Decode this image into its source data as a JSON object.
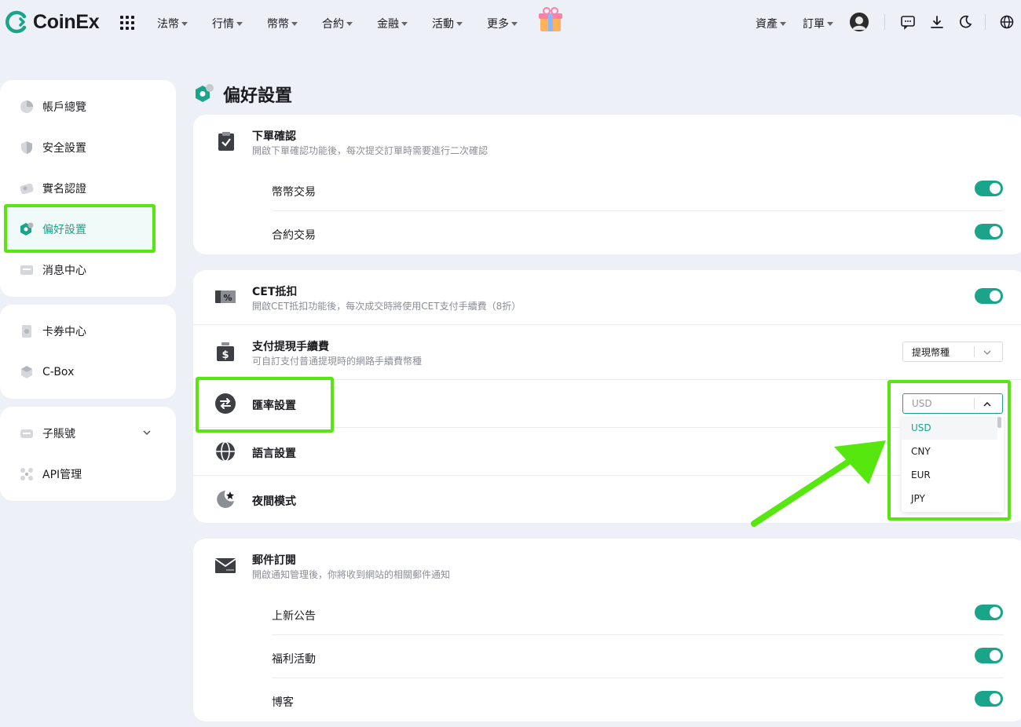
{
  "brand": {
    "name": "CoinEx",
    "accent": "#1aa58a",
    "highlight": "#56e70f"
  },
  "topnav": {
    "menu": [
      {
        "label": "法幣"
      },
      {
        "label": "行情"
      },
      {
        "label": "幣幣"
      },
      {
        "label": "合約"
      },
      {
        "label": "金融"
      },
      {
        "label": "活動"
      },
      {
        "label": "更多"
      }
    ],
    "assets_label": "資產",
    "orders_label": "訂單",
    "icons": [
      "apps-grid-icon",
      "gift-icon",
      "avatar",
      "message-icon",
      "download-icon",
      "moon-icon",
      "globe-icon"
    ]
  },
  "sidebar": {
    "group1": [
      {
        "label": "帳戶總覽",
        "icon": "pie-chart-icon"
      },
      {
        "label": "安全設置",
        "icon": "shield-icon"
      },
      {
        "label": "實名認證",
        "icon": "id-card-icon"
      },
      {
        "label": "偏好設置",
        "icon": "preferences-icon",
        "active": true
      },
      {
        "label": "消息中心",
        "icon": "message-center-icon"
      }
    ],
    "group2": [
      {
        "label": "卡券中心",
        "icon": "coupon-icon"
      },
      {
        "label": "C-Box",
        "icon": "box-icon"
      }
    ],
    "group3": [
      {
        "label": "子賬號",
        "icon": "sub-account-icon"
      },
      {
        "label": "API管理",
        "icon": "api-icon"
      }
    ]
  },
  "page": {
    "title": "偏好設置",
    "order_confirm": {
      "title": "下單確認",
      "desc": "開啟下單確認功能後，每次提交訂單時需要進行二次確認",
      "items": [
        {
          "label": "幣幣交易",
          "enabled": true
        },
        {
          "label": "合約交易",
          "enabled": true
        }
      ]
    },
    "cet_deduction": {
      "title": "CET抵扣",
      "desc": "開啟CET抵扣功能後，每次成交時將使用CET支付手續費（8折）",
      "enabled": true
    },
    "withdraw_fee": {
      "title": "支付提現手續費",
      "desc": "可自訂支付普通提現時的網路手續費幣種",
      "select_value": "提現幣種"
    },
    "exchange_rate": {
      "title": "匯率設置",
      "select_value": "USD",
      "options": [
        "USD",
        "CNY",
        "EUR",
        "JPY"
      ],
      "selected": "USD"
    },
    "language": {
      "title": "語言設置"
    },
    "night_mode": {
      "title": "夜間模式"
    },
    "email_sub": {
      "title": "郵件訂閱",
      "desc": "開啟通知管理後，你將收到網站的相關郵件通知",
      "items": [
        {
          "label": "上新公告",
          "enabled": true
        },
        {
          "label": "福利活動",
          "enabled": true
        },
        {
          "label": "博客",
          "enabled": true
        }
      ]
    }
  }
}
